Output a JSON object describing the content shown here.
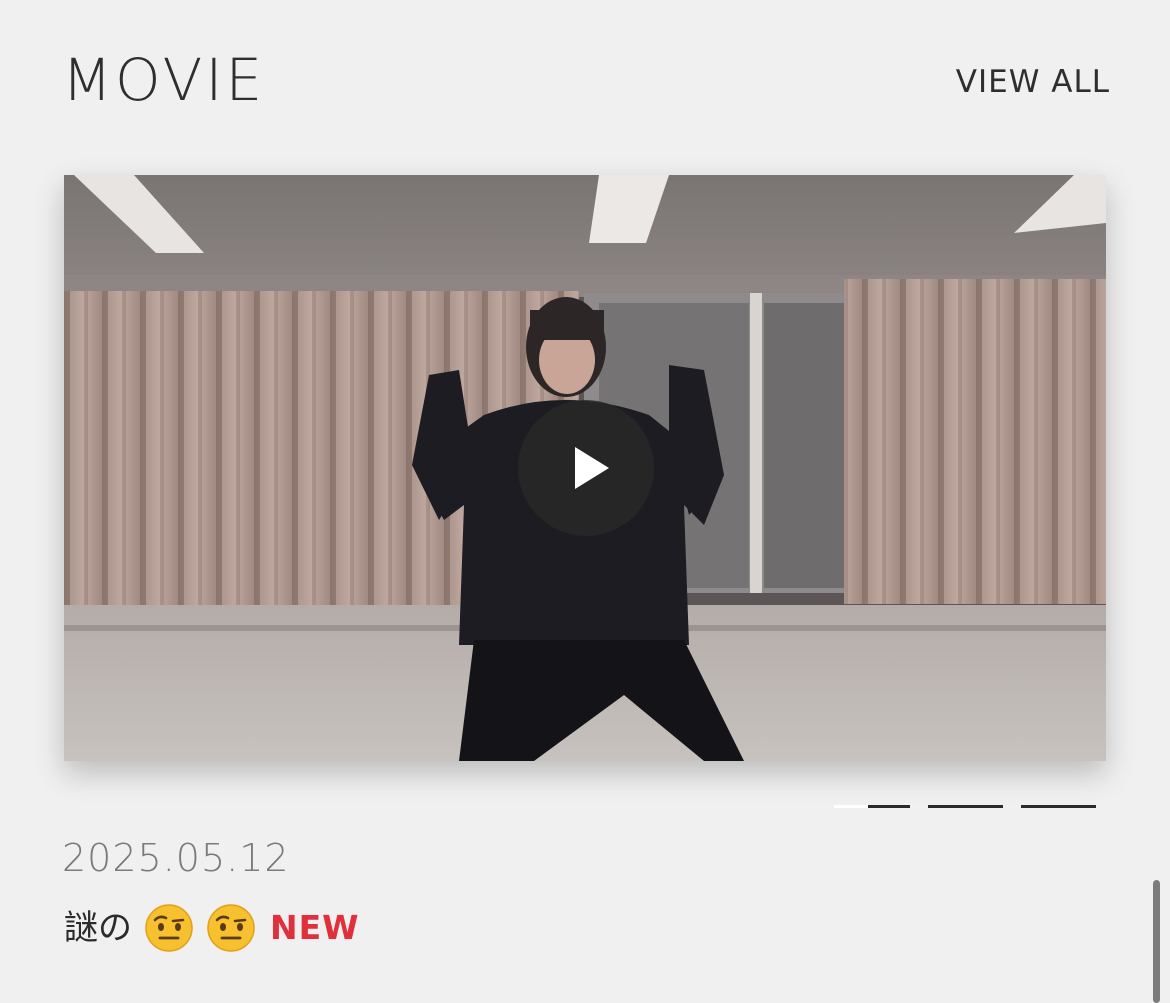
{
  "section": {
    "title": "MOVIE",
    "view_all_label": "VIEW ALL"
  },
  "video": {
    "play_icon": "play-icon"
  },
  "pager": {
    "count": 3,
    "active_index": 0,
    "active_progress": 0.45
  },
  "post": {
    "date": "2025.05.12",
    "title": "謎の",
    "emojis": [
      "face-with-raised-eyebrow-icon",
      "face-with-raised-eyebrow-icon"
    ],
    "badge": "NEW"
  },
  "colors": {
    "background": "#f0f0f0",
    "text": "#2b2b2b",
    "date_text": "#7a7a7a",
    "badge": "#e0303c",
    "play_button_bg": "#282828",
    "pager_bar": "#2a2a2a"
  }
}
